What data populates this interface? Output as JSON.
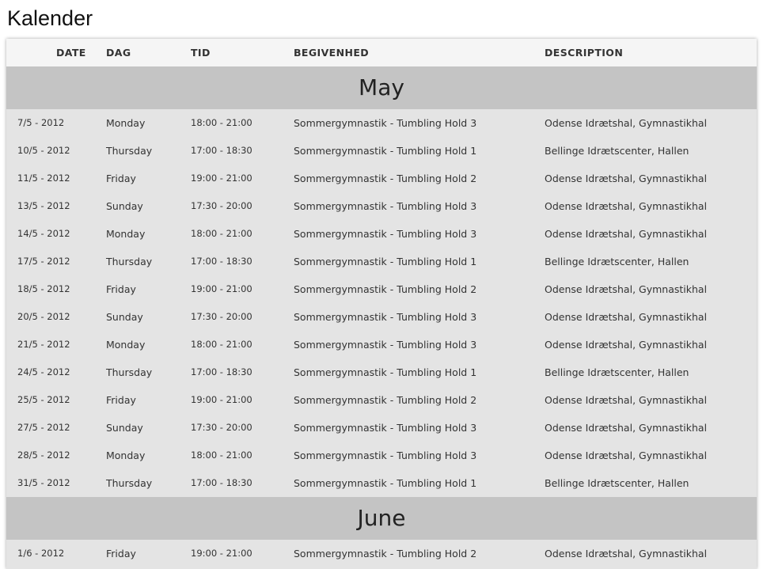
{
  "page": {
    "title": "Kalender"
  },
  "headers": {
    "date": "DATE",
    "dag": "DAG",
    "tid": "TID",
    "begivenhed": "BEGIVENHED",
    "description": "DESCRIPTION"
  },
  "months": [
    {
      "name": "May",
      "events": [
        {
          "date": "7/5 - 2012",
          "dag": "Monday",
          "tid": "18:00 - 21:00",
          "begivenhed": "Sommergymnastik - Tumbling Hold 3",
          "description": "Odense Idrætshal, Gymnastikhal"
        },
        {
          "date": "10/5 - 2012",
          "dag": "Thursday",
          "tid": "17:00 - 18:30",
          "begivenhed": "Sommergymnastik - Tumbling Hold 1",
          "description": "Bellinge Idrætscenter, Hallen"
        },
        {
          "date": "11/5 - 2012",
          "dag": "Friday",
          "tid": "19:00 - 21:00",
          "begivenhed": "Sommergymnastik - Tumbling Hold 2",
          "description": "Odense Idrætshal, Gymnastikhal"
        },
        {
          "date": "13/5 - 2012",
          "dag": "Sunday",
          "tid": "17:30 - 20:00",
          "begivenhed": "Sommergymnastik - Tumbling Hold 3",
          "description": "Odense Idrætshal, Gymnastikhal"
        },
        {
          "date": "14/5 - 2012",
          "dag": "Monday",
          "tid": "18:00 - 21:00",
          "begivenhed": "Sommergymnastik - Tumbling Hold 3",
          "description": "Odense Idrætshal, Gymnastikhal"
        },
        {
          "date": "17/5 - 2012",
          "dag": "Thursday",
          "tid": "17:00 - 18:30",
          "begivenhed": "Sommergymnastik - Tumbling Hold 1",
          "description": "Bellinge Idrætscenter, Hallen"
        },
        {
          "date": "18/5 - 2012",
          "dag": "Friday",
          "tid": "19:00 - 21:00",
          "begivenhed": "Sommergymnastik - Tumbling Hold 2",
          "description": "Odense Idrætshal, Gymnastikhal"
        },
        {
          "date": "20/5 - 2012",
          "dag": "Sunday",
          "tid": "17:30 - 20:00",
          "begivenhed": "Sommergymnastik - Tumbling Hold 3",
          "description": "Odense Idrætshal, Gymnastikhal"
        },
        {
          "date": "21/5 - 2012",
          "dag": "Monday",
          "tid": "18:00 - 21:00",
          "begivenhed": "Sommergymnastik - Tumbling Hold 3",
          "description": "Odense Idrætshal, Gymnastikhal"
        },
        {
          "date": "24/5 - 2012",
          "dag": "Thursday",
          "tid": "17:00 - 18:30",
          "begivenhed": "Sommergymnastik - Tumbling Hold 1",
          "description": "Bellinge Idrætscenter, Hallen"
        },
        {
          "date": "25/5 - 2012",
          "dag": "Friday",
          "tid": "19:00 - 21:00",
          "begivenhed": "Sommergymnastik - Tumbling Hold 2",
          "description": "Odense Idrætshal, Gymnastikhal"
        },
        {
          "date": "27/5 - 2012",
          "dag": "Sunday",
          "tid": "17:30 - 20:00",
          "begivenhed": "Sommergymnastik - Tumbling Hold 3",
          "description": "Odense Idrætshal, Gymnastikhal"
        },
        {
          "date": "28/5 - 2012",
          "dag": "Monday",
          "tid": "18:00 - 21:00",
          "begivenhed": "Sommergymnastik - Tumbling Hold 3",
          "description": "Odense Idrætshal, Gymnastikhal"
        },
        {
          "date": "31/5 - 2012",
          "dag": "Thursday",
          "tid": "17:00 - 18:30",
          "begivenhed": "Sommergymnastik - Tumbling Hold 1",
          "description": "Bellinge Idrætscenter, Hallen"
        }
      ]
    },
    {
      "name": "June",
      "events": [
        {
          "date": "1/6 - 2012",
          "dag": "Friday",
          "tid": "19:00 - 21:00",
          "begivenhed": "Sommergymnastik - Tumbling Hold 2",
          "description": "Odense Idrætshal, Gymnastikhal"
        }
      ]
    }
  ]
}
